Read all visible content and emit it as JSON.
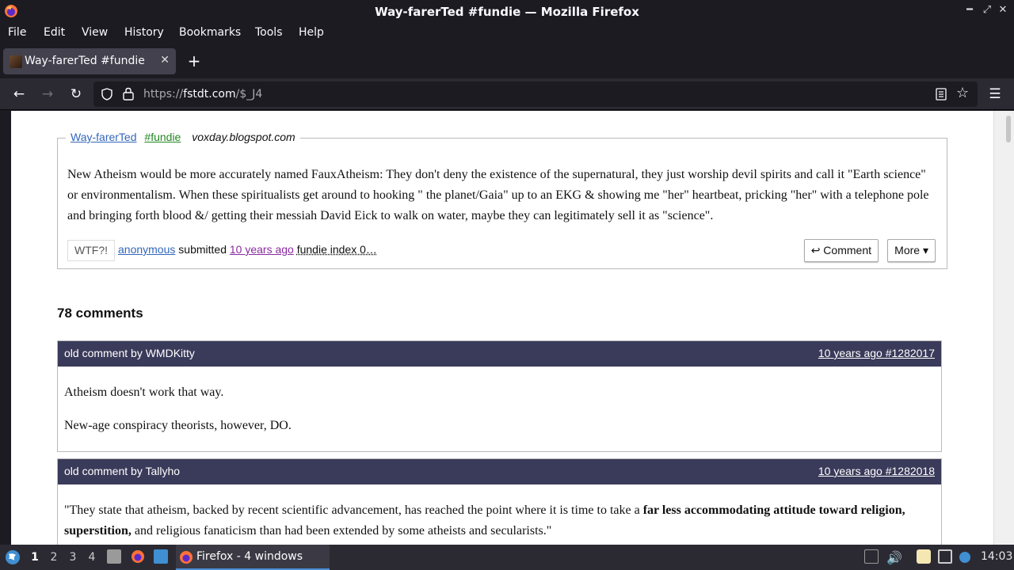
{
  "window": {
    "title": "Way-farerTed #fundie — Mozilla Firefox"
  },
  "menu": [
    "File",
    "Edit",
    "View",
    "History",
    "Bookmarks",
    "Tools",
    "Help"
  ],
  "tab": {
    "title": "Way-farerTed #fundie"
  },
  "urlbar": {
    "prefix": "https://",
    "host": "fstdt.com",
    "path": "/$_J4"
  },
  "post": {
    "author": "Way-farerTed",
    "tag": "#fundie",
    "source": "voxday.blogspot.com",
    "body": "New Atheism would be more accurately named FauxAtheism: They don't deny the existence of the supernatural, they just worship devil spirits and call it \"Earth science\" or environmentalism. When these spiritualists get around to hooking \" the planet/Gaia\" up to an EKG & showing me \"her\" heartbeat, pricking \"her\" with a telephone pole and bringing forth blood &/ getting their messiah David Eick to walk on water, maybe they can legitimately sell it as \"science\".",
    "wtf_label": "WTF?!",
    "submitter": "anonymous",
    "submitted_word": "submitted",
    "age": "10 years ago",
    "index": "fundie index 0…",
    "comment_btn": "↩ Comment",
    "more_btn": "More ▾"
  },
  "comments_count": "78 comments",
  "comments": [
    {
      "by": "old comment by WMDKitty",
      "when": "10 years ago #1282017",
      "p1": "Atheism doesn't work that way.",
      "p2": "New-age conspiracy theorists, however, DO."
    },
    {
      "by": "old comment by Tallyho",
      "when": "10 years ago #1282018",
      "p1_a": "\"They state that atheism, backed by recent scientific advancement, has reached the point where it is time to take a ",
      "p1_bold": "far less accommodating attitude toward religion, superstition,",
      "p1_b": " and religious fanaticism than had been extended by some atheists and secularists.\""
    }
  ],
  "taskbar": {
    "workspaces": [
      "1",
      "2",
      "3",
      "4"
    ],
    "task_label": "Firefox - 4 windows",
    "clock": "14:03"
  }
}
